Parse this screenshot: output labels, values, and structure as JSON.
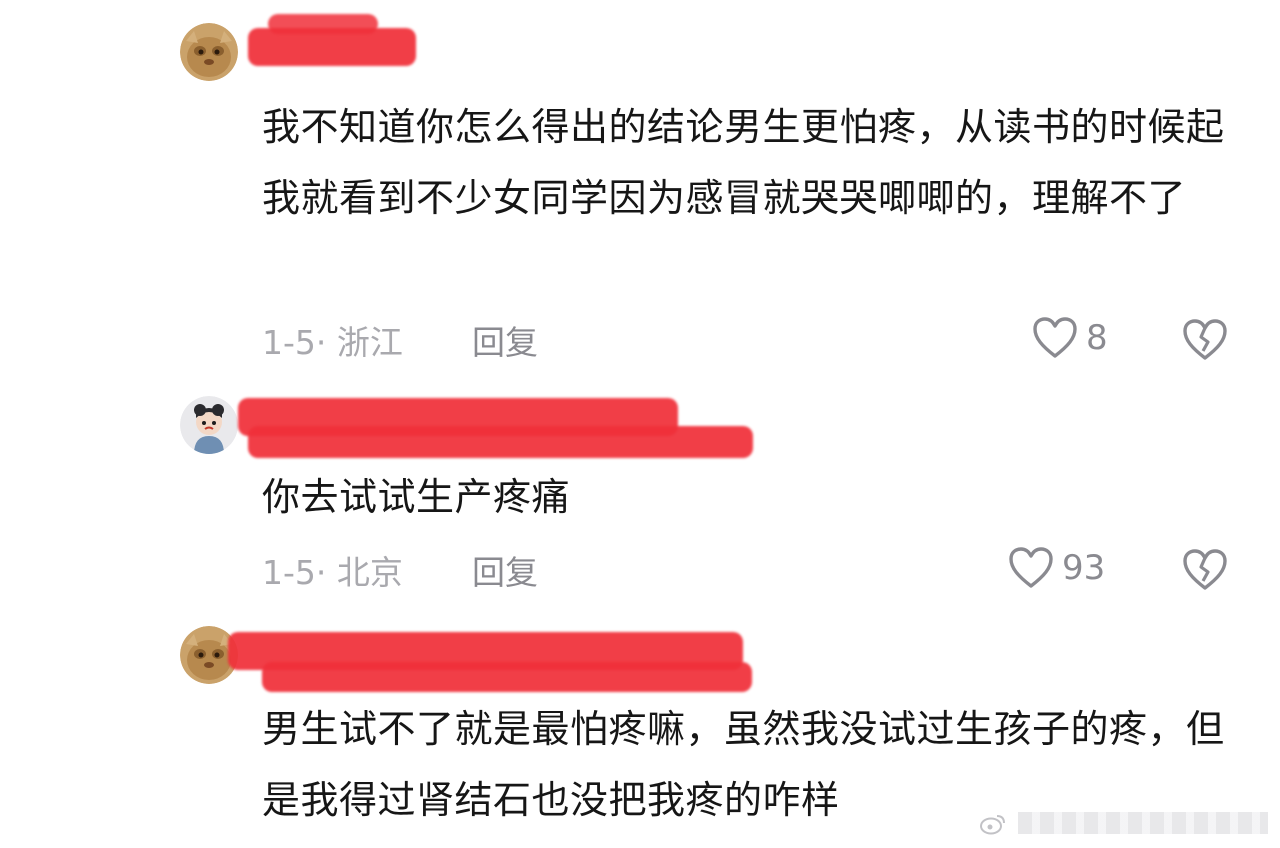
{
  "comments": [
    {
      "text": "我不知道你怎么得出的结论男生更怕疼，从读书的时候起我就看到不少女同学因为感冒就哭哭唧唧的，理解不了",
      "date_location": "1-5· 浙江",
      "reply_label": "回复",
      "likes": "8"
    },
    {
      "text": "你去试试生产疼痛",
      "date_location": "1-5· 北京",
      "reply_label": "回复",
      "likes": "93"
    },
    {
      "text": "男生试不了就是最怕疼嘛，虽然我没试过生孩子的疼，但是我得过肾结石也没把我疼的咋样"
    }
  ],
  "icons": {
    "like": "heart-outline-icon",
    "dislike": "broken-heart-icon",
    "watermark": "weibo-logo-icon"
  },
  "colors": {
    "redaction": "#f0303a",
    "meta_text": "#a9a9ae",
    "body_text": "#161616"
  }
}
